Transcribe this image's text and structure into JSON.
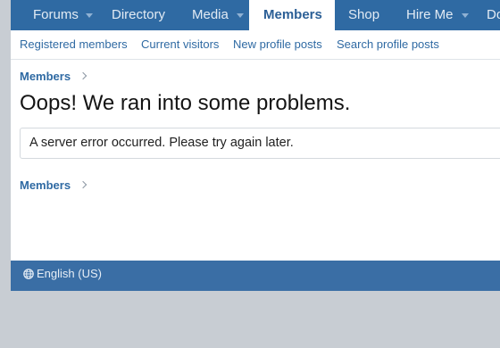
{
  "nav": {
    "items": [
      {
        "label": "Forums",
        "has_caret": true
      },
      {
        "label": "Directory",
        "has_caret": false
      },
      {
        "label": "Media",
        "has_caret": true
      },
      {
        "label": "Members",
        "active": true
      },
      {
        "label": "Shop",
        "has_caret": false
      },
      {
        "label": "Hire Me",
        "has_caret": true
      },
      {
        "label": "Do"
      }
    ]
  },
  "subnav": {
    "items": [
      {
        "label": "Registered members"
      },
      {
        "label": "Current visitors"
      },
      {
        "label": "New profile posts"
      },
      {
        "label": "Search profile posts"
      }
    ]
  },
  "breadcrumb": {
    "label": "Members"
  },
  "page_title": "Oops! We ran into some problems.",
  "error_message": "A server error occurred. Please try again later.",
  "footer": {
    "language": "English (US)",
    "language_icon": "globe-icon"
  },
  "colors": {
    "nav_bg": "#2f6aa3",
    "link": "#2f6aa3",
    "footer_bg": "#3a6ea5"
  }
}
